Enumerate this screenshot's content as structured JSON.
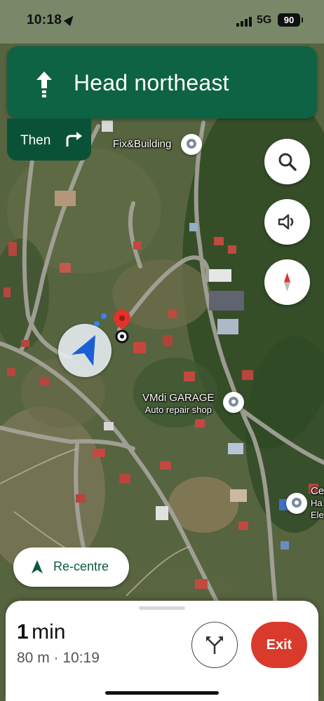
{
  "status_bar": {
    "time": "10:18",
    "network": "5G",
    "battery": "90"
  },
  "navigation": {
    "instruction": "Head northeast",
    "then_label": "Then",
    "then_icon": "turn-right-arrow-icon",
    "colors": {
      "banner": "#0d6343",
      "then": "#0a5237"
    }
  },
  "map": {
    "places": [
      {
        "name": "Fix&Building",
        "subtitle": ""
      },
      {
        "name": "VMdi GARAGE",
        "subtitle": "Auto repair shop"
      },
      {
        "name": "Ce",
        "subtitle": "Ha",
        "subtitle2": "Ele"
      }
    ]
  },
  "controls": {
    "search_icon": "search-icon",
    "sound_icon": "volume-icon",
    "compass_icon": "compass-icon"
  },
  "recentre": {
    "label": "Re-centre"
  },
  "trip": {
    "eta_number": "1",
    "eta_unit": "min",
    "details": "80 m · 10:19",
    "exit_label": "Exit",
    "exit_color": "#d93a2b"
  }
}
